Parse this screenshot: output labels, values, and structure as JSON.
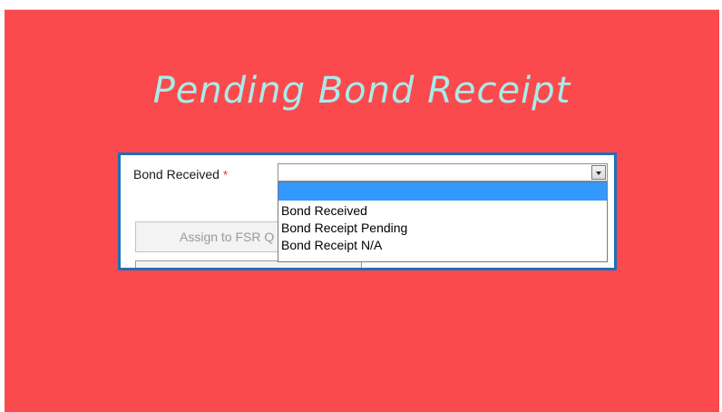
{
  "title": "Pending Bond Receipt",
  "form": {
    "field_label": "Bond Received",
    "required_marker": "*",
    "select_value": "",
    "dropdown_options": [
      "",
      "Bond Received",
      "Bond Receipt Pending",
      "Bond Receipt N/A"
    ],
    "selected_index": 0,
    "assign_button_label": "Assign to FSR Q",
    "second_button_label": ""
  },
  "colors": {
    "background": "#fa4a4d",
    "title": "#a8ece9",
    "panel_border": "#1f6fb8",
    "highlight": "#3399ff",
    "required": "#d9302f"
  },
  "icons": {
    "dropdown_arrow": "chevron-down-icon"
  }
}
